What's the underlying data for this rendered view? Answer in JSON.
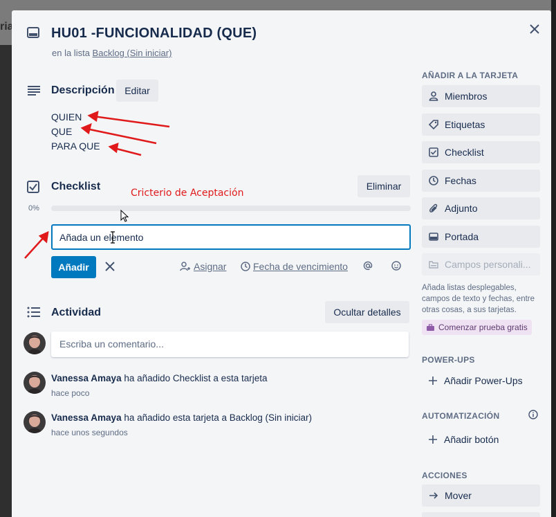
{
  "backdrop": {
    "peek_text": "ria"
  },
  "card": {
    "title": "HU01 -FUNCIONALIDAD (QUE)",
    "list_prefix": "en la lista",
    "list_name": "Backlog (Sin iniciar)"
  },
  "description": {
    "heading": "Descripción",
    "edit_label": "Editar",
    "lines": [
      "QUIEN",
      "QUE",
      "PARA QUE"
    ]
  },
  "checklist": {
    "heading": "Checklist",
    "annotation": "Cricterio de Aceptación",
    "delete_label": "Eliminar",
    "progress_label": "0%",
    "progress_value": 0,
    "input_value": "Añada un elemento",
    "add_label": "Añadir",
    "assign_label": "Asignar",
    "due_label": "Fecha de vencimiento"
  },
  "activity": {
    "heading": "Actividad",
    "toggle_label": "Ocultar detalles",
    "comment_placeholder": "Escriba un comentario...",
    "entries": [
      {
        "user": "Vanessa Amaya",
        "action": "ha añadido Checklist a esta tarjeta",
        "time": "hace poco"
      },
      {
        "user": "Vanessa Amaya",
        "action": "ha añadido esta tarjeta a Backlog (Sin iniciar)",
        "time": "hace unos segundos"
      }
    ]
  },
  "sidebar": {
    "add_heading": "AÑADIR A LA TARJETA",
    "add_items": [
      {
        "label": "Miembros",
        "icon": "person-icon"
      },
      {
        "label": "Etiquetas",
        "icon": "tag-icon"
      },
      {
        "label": "Checklist",
        "icon": "checkbox-icon"
      },
      {
        "label": "Fechas",
        "icon": "clock-icon"
      },
      {
        "label": "Adjunto",
        "icon": "paperclip-icon"
      },
      {
        "label": "Portada",
        "icon": "card-cover-icon"
      },
      {
        "label": "Campos personali...",
        "icon": "custom-fields-icon"
      }
    ],
    "custom_fields_note": "Añada listas desplegables, campos de texto y fechas, entre otras cosas, a sus tarjetas.",
    "trial_label": "Comenzar prueba gratis",
    "powerups_heading": "POWER-UPS",
    "powerups_add": "Añadir Power-Ups",
    "automation_heading": "AUTOMATIZACIÓN",
    "automation_add": "Añadir botón",
    "actions_heading": "ACCIONES",
    "move_label": "Mover"
  },
  "colors": {
    "primary": "#0079bf",
    "annotation_red": "#e0191a",
    "modal_bg": "#f4f5f7",
    "button_gray": "#e9eaee"
  }
}
